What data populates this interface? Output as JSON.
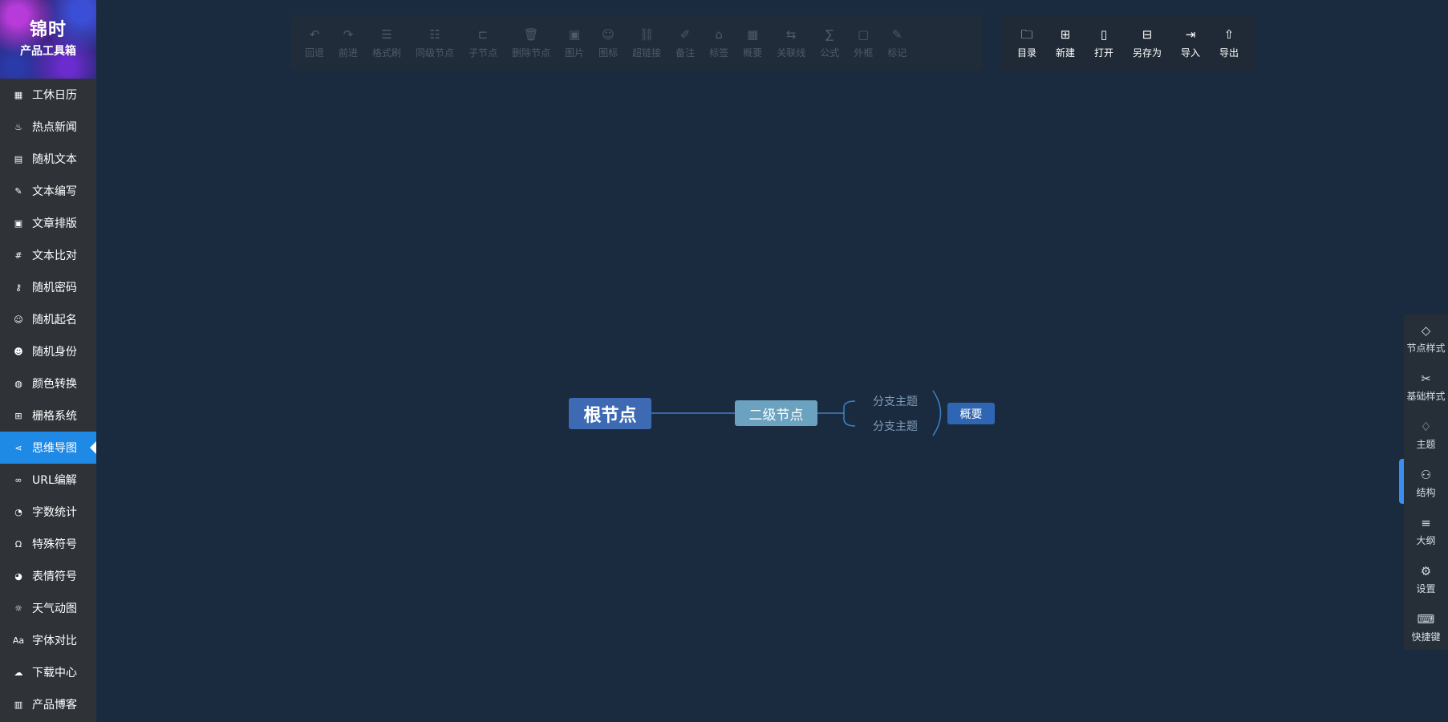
{
  "logo": {
    "line1": "锦时",
    "line2": "产品工具箱"
  },
  "sidebar": {
    "items": [
      {
        "label": "工休日历",
        "icon": "calendar-icon",
        "glyph": "▦"
      },
      {
        "label": "热点新闻",
        "icon": "flame-icon",
        "glyph": "♨"
      },
      {
        "label": "随机文本",
        "icon": "document-icon",
        "glyph": "▤"
      },
      {
        "label": "文本编写",
        "icon": "pen-icon",
        "glyph": "✎"
      },
      {
        "label": "文章排版",
        "icon": "image-icon",
        "glyph": "▣"
      },
      {
        "label": "文本比对",
        "icon": "hash-icon",
        "glyph": "#"
      },
      {
        "label": "随机密码",
        "icon": "key-icon",
        "glyph": "⚷"
      },
      {
        "label": "随机起名",
        "icon": "smile-icon",
        "glyph": "☺"
      },
      {
        "label": "随机身份",
        "icon": "user-icon",
        "glyph": "☻"
      },
      {
        "label": "颜色转换",
        "icon": "palette-icon",
        "glyph": "◍"
      },
      {
        "label": "栅格系统",
        "icon": "grid-icon",
        "glyph": "⊞"
      },
      {
        "label": "思维导图",
        "icon": "mindmap-icon",
        "glyph": "⋖",
        "active": true
      },
      {
        "label": "URL编解",
        "icon": "link-icon",
        "glyph": "∞"
      },
      {
        "label": "字数统计",
        "icon": "pie-chart-icon",
        "glyph": "◔"
      },
      {
        "label": "特殊符号",
        "icon": "omega-icon",
        "glyph": "Ω"
      },
      {
        "label": "表情符号",
        "icon": "emoji-icon",
        "glyph": "◕"
      },
      {
        "label": "天气动图",
        "icon": "sun-icon",
        "glyph": "☼"
      },
      {
        "label": "字体对比",
        "icon": "font-icon",
        "glyph": "Aa"
      },
      {
        "label": "下载中心",
        "icon": "cloud-download-icon",
        "glyph": "☁"
      },
      {
        "label": "产品博客",
        "icon": "blog-icon",
        "glyph": "▥"
      }
    ]
  },
  "toolbar_edit": {
    "buttons": [
      {
        "label": "回退",
        "icon": "undo-icon",
        "glyph": "↶"
      },
      {
        "label": "前进",
        "icon": "redo-icon",
        "glyph": "↷"
      },
      {
        "label": "格式刷",
        "icon": "format-brush-icon",
        "glyph": "☰"
      },
      {
        "label": "同级节点",
        "icon": "sibling-node-icon",
        "glyph": "☷"
      },
      {
        "label": "子节点",
        "icon": "child-node-icon",
        "glyph": "⊏"
      },
      {
        "label": "删除节点",
        "icon": "trash-icon",
        "glyph": "🗑"
      },
      {
        "label": "图片",
        "icon": "picture-icon",
        "glyph": "▣"
      },
      {
        "label": "图标",
        "icon": "smiley-icon",
        "glyph": "☺"
      },
      {
        "label": "超链接",
        "icon": "hyperlink-icon",
        "glyph": "⛓"
      },
      {
        "label": "备注",
        "icon": "note-icon",
        "glyph": "✐"
      },
      {
        "label": "标签",
        "icon": "tag-icon",
        "glyph": "⌂"
      },
      {
        "label": "概要",
        "icon": "summary-icon",
        "glyph": "▦"
      },
      {
        "label": "关联线",
        "icon": "relation-line-icon",
        "glyph": "⇆"
      },
      {
        "label": "公式",
        "icon": "formula-icon",
        "glyph": "∑"
      },
      {
        "label": "外框",
        "icon": "frame-icon",
        "glyph": "▢"
      },
      {
        "label": "标记",
        "icon": "marker-icon",
        "glyph": "✎"
      }
    ]
  },
  "toolbar_file": {
    "buttons": [
      {
        "label": "目录",
        "icon": "folder-icon",
        "glyph": "🗀"
      },
      {
        "label": "新建",
        "icon": "new-file-icon",
        "glyph": "⊞"
      },
      {
        "label": "打开",
        "icon": "open-file-icon",
        "glyph": "▯"
      },
      {
        "label": "另存为",
        "icon": "save-as-icon",
        "glyph": "⊟"
      },
      {
        "label": "导入",
        "icon": "import-icon",
        "glyph": "⇥"
      },
      {
        "label": "导出",
        "icon": "export-icon",
        "glyph": "⇧"
      }
    ]
  },
  "mindmap": {
    "root": "根节点",
    "second": "二级节点",
    "branches": [
      "分支主题",
      "分支主题"
    ],
    "summary": "概要",
    "line_color": "#3d82c8"
  },
  "right_panel": {
    "items": [
      {
        "label": "节点样式",
        "icon": "node-style-icon",
        "glyph": "◇"
      },
      {
        "label": "基础样式",
        "icon": "tools-icon",
        "glyph": "✂"
      },
      {
        "label": "主题",
        "icon": "shirt-icon",
        "glyph": "♢"
      },
      {
        "label": "结构",
        "icon": "structure-icon",
        "glyph": "⚇",
        "active": true
      },
      {
        "label": "大纲",
        "icon": "outline-icon",
        "glyph": "≡"
      },
      {
        "label": "设置",
        "icon": "settings-icon",
        "glyph": "⚙"
      },
      {
        "label": "快捷键",
        "icon": "keyboard-icon",
        "glyph": "⌨"
      }
    ]
  }
}
